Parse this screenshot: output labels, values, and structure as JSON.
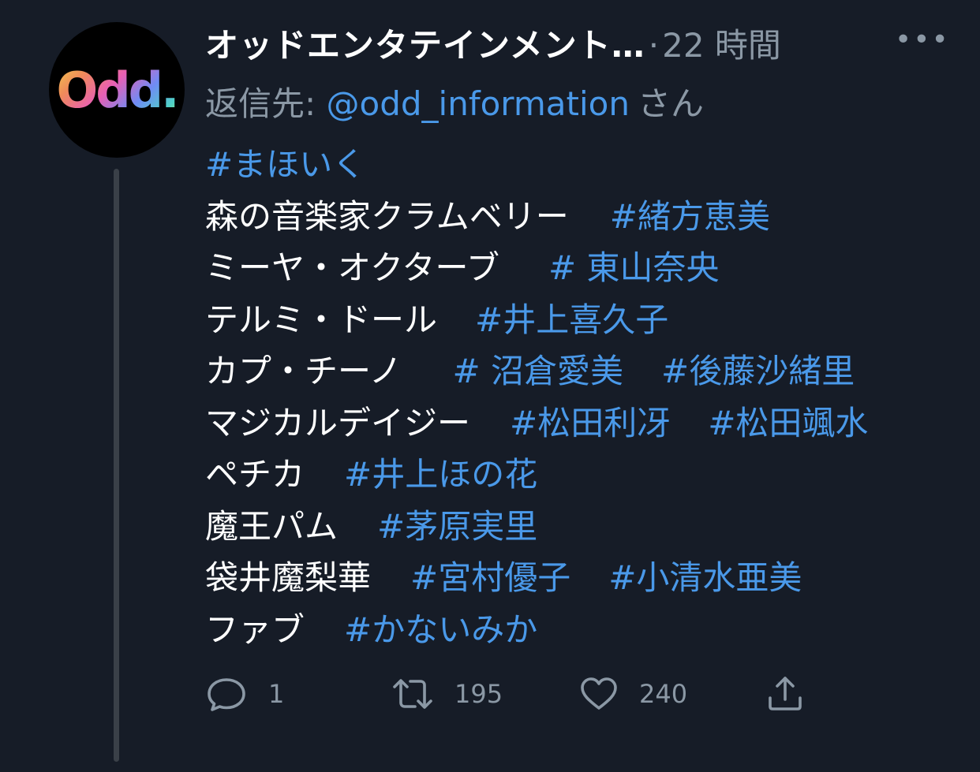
{
  "tweet": {
    "display_name": "オッドエンタテインメント…",
    "separator": "·",
    "time": "22 時間",
    "more_label": "•••",
    "avatar_text": "Odd.",
    "reply_label": "返信先:",
    "reply_handle": "@odd_information",
    "reply_suffix": "さん",
    "lines": [
      {
        "hashtag": "#まほいく"
      },
      {
        "character": "森の音楽家クラムベリー",
        "tags": [
          "#緒方恵美"
        ]
      },
      {
        "character": "ミーヤ・オクターブ",
        "tags": [
          "# 東山奈央"
        ]
      },
      {
        "character": "テルミ・ドール",
        "tags": [
          "#井上喜久子"
        ]
      },
      {
        "character": "カプ・チーノ",
        "tags": [
          "# 沼倉愛美",
          "#後藤沙緒里"
        ]
      },
      {
        "character": "マジカルデイジー",
        "tags": [
          "#松田利冴",
          "#松田颯水"
        ]
      },
      {
        "character": "ペチカ",
        "tags": [
          "#井上ほの花"
        ]
      },
      {
        "character": "魔王パム",
        "tags": [
          "#茅原実里"
        ]
      },
      {
        "character": "袋井魔梨華",
        "tags": [
          "#宮村優子",
          "#小清水亜美"
        ]
      },
      {
        "character": "ファブ",
        "tags": [
          "#かないみか"
        ]
      }
    ],
    "actions": {
      "reply_icon": "reply-icon",
      "reply_count": "1",
      "retweet_icon": "retweet-icon",
      "retweet_count": "195",
      "like_icon": "heart-icon",
      "like_count": "240",
      "share_icon": "share-icon"
    },
    "colors": {
      "background": "#161c27",
      "link": "#4a99e9",
      "secondary": "#8b98a5"
    }
  }
}
